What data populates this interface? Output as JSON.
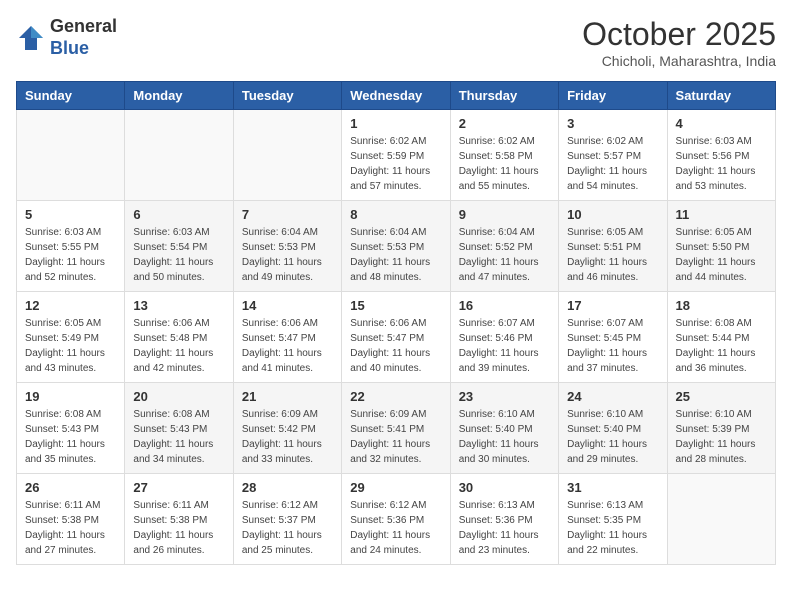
{
  "header": {
    "logo": {
      "general": "General",
      "blue": "Blue"
    },
    "title": "October 2025",
    "location": "Chicholi, Maharashtra, India"
  },
  "days_of_week": [
    "Sunday",
    "Monday",
    "Tuesday",
    "Wednesday",
    "Thursday",
    "Friday",
    "Saturday"
  ],
  "weeks": [
    [
      {
        "day": "",
        "sunrise": "",
        "sunset": "",
        "daylight": ""
      },
      {
        "day": "",
        "sunrise": "",
        "sunset": "",
        "daylight": ""
      },
      {
        "day": "",
        "sunrise": "",
        "sunset": "",
        "daylight": ""
      },
      {
        "day": "1",
        "sunrise": "Sunrise: 6:02 AM",
        "sunset": "Sunset: 5:59 PM",
        "daylight": "Daylight: 11 hours and 57 minutes."
      },
      {
        "day": "2",
        "sunrise": "Sunrise: 6:02 AM",
        "sunset": "Sunset: 5:58 PM",
        "daylight": "Daylight: 11 hours and 55 minutes."
      },
      {
        "day": "3",
        "sunrise": "Sunrise: 6:02 AM",
        "sunset": "Sunset: 5:57 PM",
        "daylight": "Daylight: 11 hours and 54 minutes."
      },
      {
        "day": "4",
        "sunrise": "Sunrise: 6:03 AM",
        "sunset": "Sunset: 5:56 PM",
        "daylight": "Daylight: 11 hours and 53 minutes."
      }
    ],
    [
      {
        "day": "5",
        "sunrise": "Sunrise: 6:03 AM",
        "sunset": "Sunset: 5:55 PM",
        "daylight": "Daylight: 11 hours and 52 minutes."
      },
      {
        "day": "6",
        "sunrise": "Sunrise: 6:03 AM",
        "sunset": "Sunset: 5:54 PM",
        "daylight": "Daylight: 11 hours and 50 minutes."
      },
      {
        "day": "7",
        "sunrise": "Sunrise: 6:04 AM",
        "sunset": "Sunset: 5:53 PM",
        "daylight": "Daylight: 11 hours and 49 minutes."
      },
      {
        "day": "8",
        "sunrise": "Sunrise: 6:04 AM",
        "sunset": "Sunset: 5:53 PM",
        "daylight": "Daylight: 11 hours and 48 minutes."
      },
      {
        "day": "9",
        "sunrise": "Sunrise: 6:04 AM",
        "sunset": "Sunset: 5:52 PM",
        "daylight": "Daylight: 11 hours and 47 minutes."
      },
      {
        "day": "10",
        "sunrise": "Sunrise: 6:05 AM",
        "sunset": "Sunset: 5:51 PM",
        "daylight": "Daylight: 11 hours and 46 minutes."
      },
      {
        "day": "11",
        "sunrise": "Sunrise: 6:05 AM",
        "sunset": "Sunset: 5:50 PM",
        "daylight": "Daylight: 11 hours and 44 minutes."
      }
    ],
    [
      {
        "day": "12",
        "sunrise": "Sunrise: 6:05 AM",
        "sunset": "Sunset: 5:49 PM",
        "daylight": "Daylight: 11 hours and 43 minutes."
      },
      {
        "day": "13",
        "sunrise": "Sunrise: 6:06 AM",
        "sunset": "Sunset: 5:48 PM",
        "daylight": "Daylight: 11 hours and 42 minutes."
      },
      {
        "day": "14",
        "sunrise": "Sunrise: 6:06 AM",
        "sunset": "Sunset: 5:47 PM",
        "daylight": "Daylight: 11 hours and 41 minutes."
      },
      {
        "day": "15",
        "sunrise": "Sunrise: 6:06 AM",
        "sunset": "Sunset: 5:47 PM",
        "daylight": "Daylight: 11 hours and 40 minutes."
      },
      {
        "day": "16",
        "sunrise": "Sunrise: 6:07 AM",
        "sunset": "Sunset: 5:46 PM",
        "daylight": "Daylight: 11 hours and 39 minutes."
      },
      {
        "day": "17",
        "sunrise": "Sunrise: 6:07 AM",
        "sunset": "Sunset: 5:45 PM",
        "daylight": "Daylight: 11 hours and 37 minutes."
      },
      {
        "day": "18",
        "sunrise": "Sunrise: 6:08 AM",
        "sunset": "Sunset: 5:44 PM",
        "daylight": "Daylight: 11 hours and 36 minutes."
      }
    ],
    [
      {
        "day": "19",
        "sunrise": "Sunrise: 6:08 AM",
        "sunset": "Sunset: 5:43 PM",
        "daylight": "Daylight: 11 hours and 35 minutes."
      },
      {
        "day": "20",
        "sunrise": "Sunrise: 6:08 AM",
        "sunset": "Sunset: 5:43 PM",
        "daylight": "Daylight: 11 hours and 34 minutes."
      },
      {
        "day": "21",
        "sunrise": "Sunrise: 6:09 AM",
        "sunset": "Sunset: 5:42 PM",
        "daylight": "Daylight: 11 hours and 33 minutes."
      },
      {
        "day": "22",
        "sunrise": "Sunrise: 6:09 AM",
        "sunset": "Sunset: 5:41 PM",
        "daylight": "Daylight: 11 hours and 32 minutes."
      },
      {
        "day": "23",
        "sunrise": "Sunrise: 6:10 AM",
        "sunset": "Sunset: 5:40 PM",
        "daylight": "Daylight: 11 hours and 30 minutes."
      },
      {
        "day": "24",
        "sunrise": "Sunrise: 6:10 AM",
        "sunset": "Sunset: 5:40 PM",
        "daylight": "Daylight: 11 hours and 29 minutes."
      },
      {
        "day": "25",
        "sunrise": "Sunrise: 6:10 AM",
        "sunset": "Sunset: 5:39 PM",
        "daylight": "Daylight: 11 hours and 28 minutes."
      }
    ],
    [
      {
        "day": "26",
        "sunrise": "Sunrise: 6:11 AM",
        "sunset": "Sunset: 5:38 PM",
        "daylight": "Daylight: 11 hours and 27 minutes."
      },
      {
        "day": "27",
        "sunrise": "Sunrise: 6:11 AM",
        "sunset": "Sunset: 5:38 PM",
        "daylight": "Daylight: 11 hours and 26 minutes."
      },
      {
        "day": "28",
        "sunrise": "Sunrise: 6:12 AM",
        "sunset": "Sunset: 5:37 PM",
        "daylight": "Daylight: 11 hours and 25 minutes."
      },
      {
        "day": "29",
        "sunrise": "Sunrise: 6:12 AM",
        "sunset": "Sunset: 5:36 PM",
        "daylight": "Daylight: 11 hours and 24 minutes."
      },
      {
        "day": "30",
        "sunrise": "Sunrise: 6:13 AM",
        "sunset": "Sunset: 5:36 PM",
        "daylight": "Daylight: 11 hours and 23 minutes."
      },
      {
        "day": "31",
        "sunrise": "Sunrise: 6:13 AM",
        "sunset": "Sunset: 5:35 PM",
        "daylight": "Daylight: 11 hours and 22 minutes."
      },
      {
        "day": "",
        "sunrise": "",
        "sunset": "",
        "daylight": ""
      }
    ]
  ]
}
